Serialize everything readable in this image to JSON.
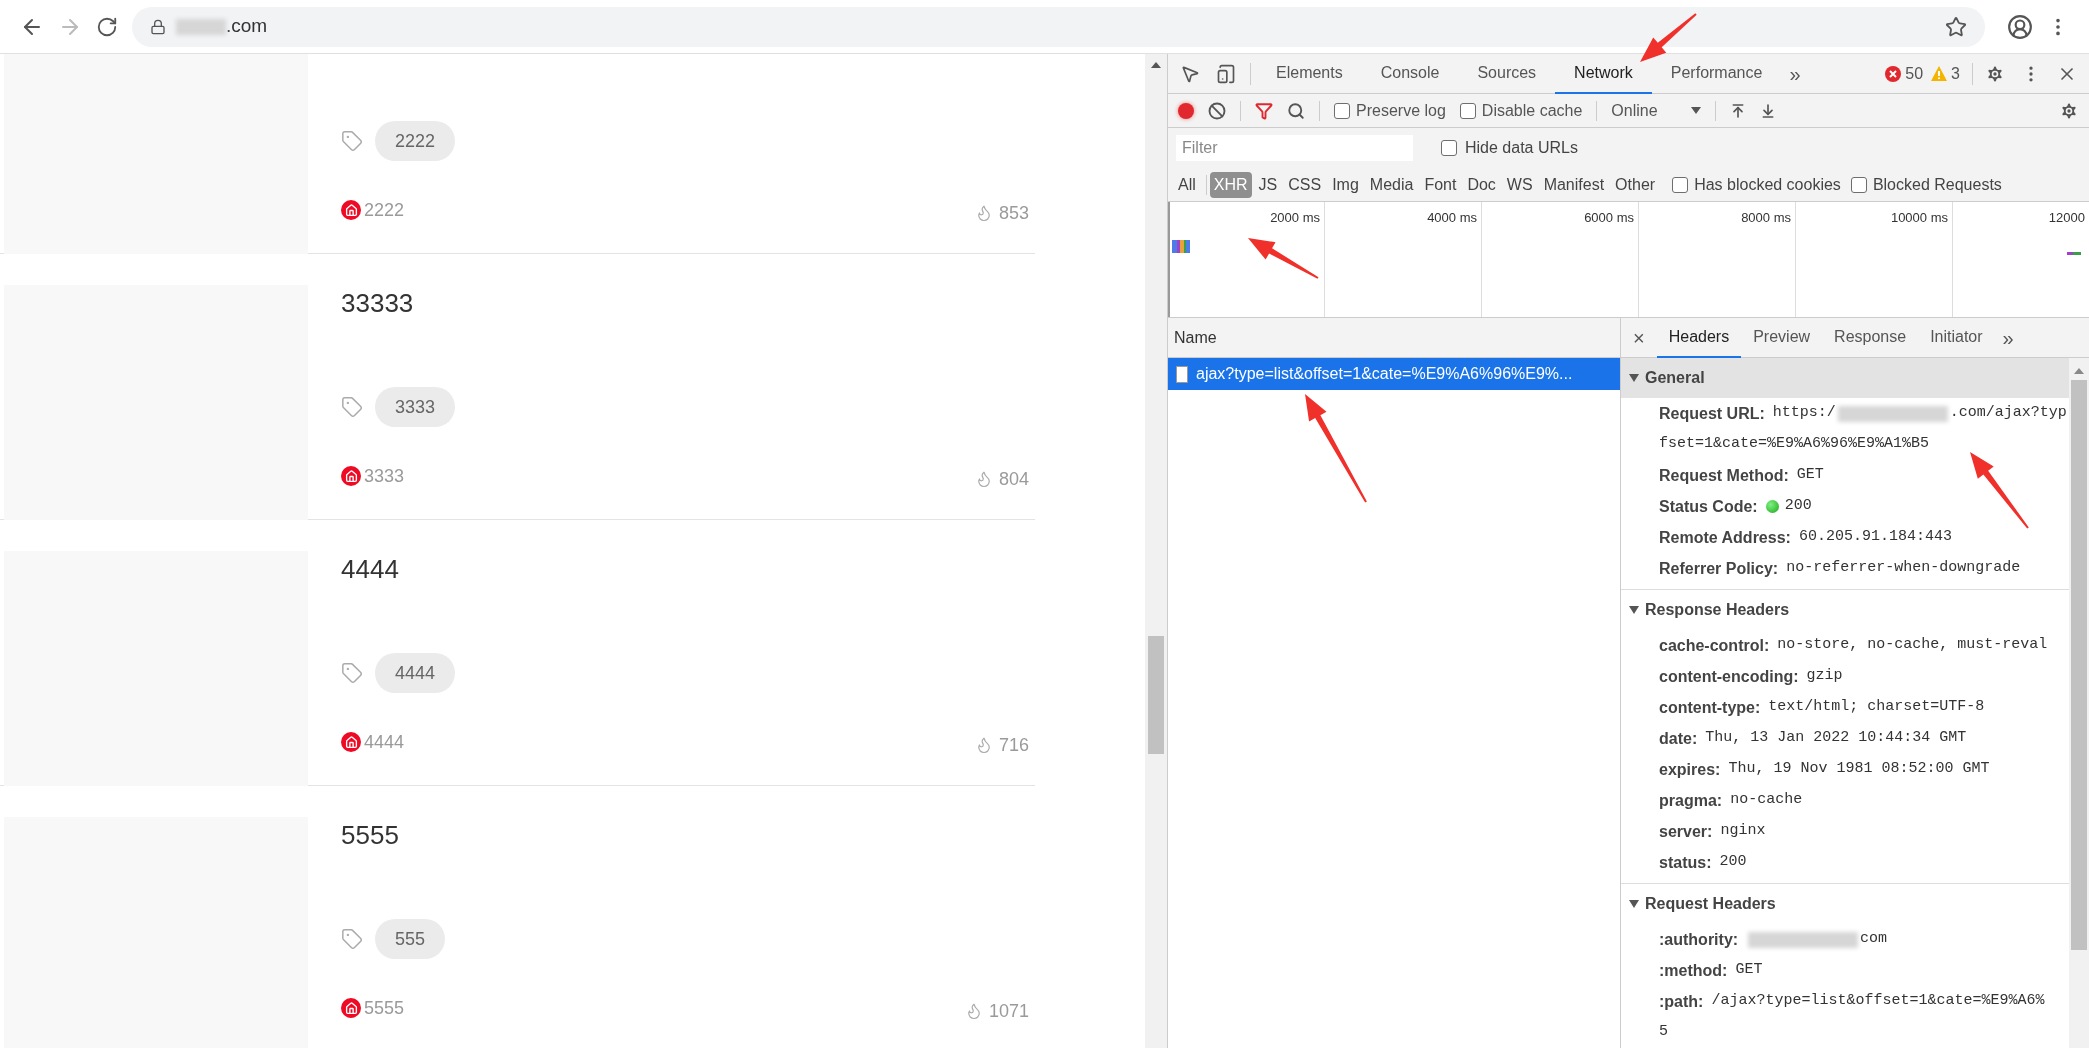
{
  "browser": {
    "url": ".com"
  },
  "page": {
    "cards": [
      {
        "tag": "2222",
        "author": "2222",
        "views": "853"
      },
      {
        "title": "33333",
        "tag": "3333",
        "author": "3333",
        "views": "804"
      },
      {
        "title": "4444",
        "tag": "4444",
        "author": "4444",
        "views": "716"
      },
      {
        "title": "5555",
        "tag": "555",
        "author": "5555",
        "views": "1071"
      }
    ]
  },
  "devtools": {
    "tabs": [
      {
        "label": "Elements",
        "selected": false
      },
      {
        "label": "Console",
        "selected": false
      },
      {
        "label": "Sources",
        "selected": false
      },
      {
        "label": "Network",
        "selected": true
      },
      {
        "label": "Performance",
        "selected": false
      }
    ],
    "more_tabs": "»",
    "errors": "50",
    "warnings": "3",
    "toolbar": {
      "recording": true,
      "options": [
        {
          "label": "Preserve log",
          "checked": false
        },
        {
          "label": "Disable cache",
          "checked": false
        }
      ],
      "throttling": "Online"
    },
    "filter": {
      "placeholder": "Filter",
      "hide_data_urls": {
        "label": "Hide data URLs",
        "checked": false
      }
    },
    "types": [
      {
        "label": "All",
        "selected": false
      },
      {
        "label": "XHR",
        "selected": true
      },
      {
        "label": "JS",
        "selected": false
      },
      {
        "label": "CSS",
        "selected": false
      },
      {
        "label": "Img",
        "selected": false
      },
      {
        "label": "Media",
        "selected": false
      },
      {
        "label": "Font",
        "selected": false
      },
      {
        "label": "Doc",
        "selected": false
      },
      {
        "label": "WS",
        "selected": false
      },
      {
        "label": "Manifest",
        "selected": false
      },
      {
        "label": "Other",
        "selected": false
      }
    ],
    "type_options": [
      {
        "label": "Has blocked cookies",
        "checked": false
      },
      {
        "label": "Blocked Requests",
        "checked": false
      }
    ],
    "timeline": {
      "ticks": [
        "2000 ms",
        "4000 ms",
        "6000 ms",
        "8000 ms",
        "10000 ms",
        "12000"
      ]
    },
    "requests": {
      "column": "Name",
      "rows": [
        {
          "name": "ajax?type=list&offset=1&cate=%E9%A6%96%E9%...",
          "selected": true
        }
      ]
    },
    "details": {
      "close": "×",
      "tabs": [
        {
          "label": "Headers",
          "selected": true
        },
        {
          "label": "Preview",
          "selected": false
        },
        {
          "label": "Response",
          "selected": false
        },
        {
          "label": "Initiator",
          "selected": false
        }
      ],
      "more_tabs": "»",
      "sections": [
        {
          "title": "General",
          "expanded": true,
          "focused": true,
          "rows": [
            {
              "kind": "redacted",
              "key": "Request URL:",
              "before": "https:/",
              "after": ".com/ajax?typ",
              "continuation": "fset=1&cate=%E9%A6%96%E9%A1%B5"
            },
            {
              "kind": "text",
              "key": "Request Method:",
              "value": "GET"
            },
            {
              "kind": "status",
              "key": "Status Code:",
              "value": "200"
            },
            {
              "kind": "text",
              "key": "Remote Address:",
              "value": "60.205.91.184:443"
            },
            {
              "kind": "text",
              "key": "Referrer Policy:",
              "value": "no-referrer-when-downgrade"
            }
          ]
        },
        {
          "title": "Response Headers",
          "expanded": true,
          "focused": false,
          "rows": [
            {
              "kind": "text",
              "key": "cache-control:",
              "value": "no-store, no-cache, must-reval"
            },
            {
              "kind": "text",
              "key": "content-encoding:",
              "value": "gzip"
            },
            {
              "kind": "text",
              "key": "content-type:",
              "value": "text/html; charset=UTF-8"
            },
            {
              "kind": "text",
              "key": "date:",
              "value": "Thu, 13 Jan 2022 10:44:34 GMT"
            },
            {
              "kind": "text",
              "key": "expires:",
              "value": "Thu, 19 Nov 1981 08:52:00 GMT"
            },
            {
              "kind": "text",
              "key": "pragma:",
              "value": "no-cache"
            },
            {
              "kind": "text",
              "key": "server:",
              "value": "nginx"
            },
            {
              "kind": "text",
              "key": "status:",
              "value": "200"
            }
          ]
        },
        {
          "title": "Request Headers",
          "expanded": true,
          "focused": false,
          "rows": [
            {
              "kind": "redacted",
              "key": ":authority:",
              "before": "",
              "after": "com"
            },
            {
              "kind": "text",
              "key": ":method:",
              "value": "GET"
            },
            {
              "kind": "text",
              "key": ":path:",
              "value": "/ajax?type=list&offset=1&cate=%E9%A6%",
              "continuation": "5"
            }
          ]
        }
      ]
    }
  }
}
